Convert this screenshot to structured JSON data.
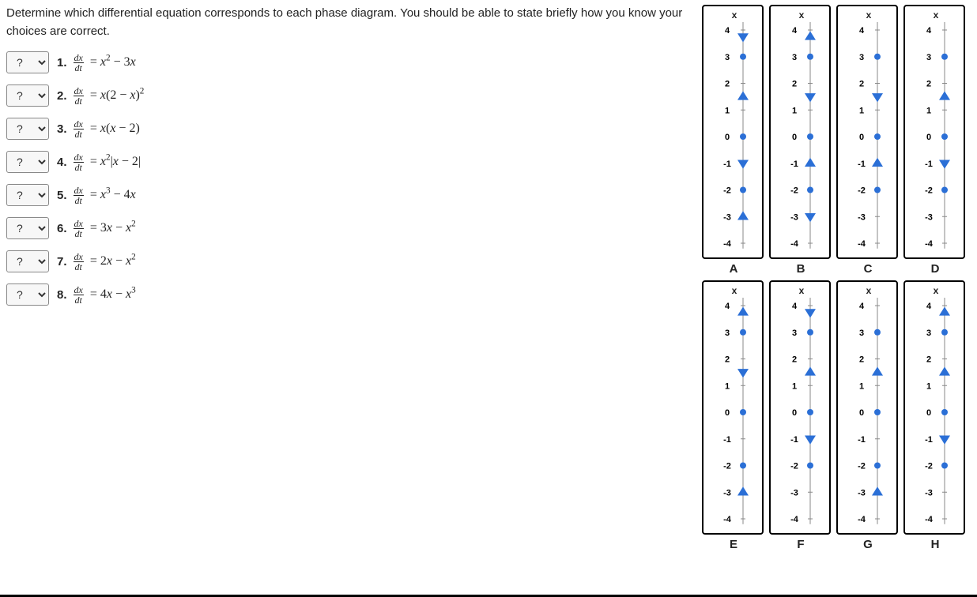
{
  "prompt": "Determine which differential equation corresponds to each phase diagram. You should be able to state briefly how you know your choices are correct.",
  "select_placeholder": "?",
  "questions": [
    {
      "num": "1.",
      "latex": "x² − 3x"
    },
    {
      "num": "2.",
      "latex": "x(2 − x)²"
    },
    {
      "num": "3.",
      "latex": "x(x − 2)"
    },
    {
      "num": "4.",
      "latex": "x²|x − 2|"
    },
    {
      "num": "5.",
      "latex": "x³ − 4x"
    },
    {
      "num": "6.",
      "latex": "3x − x²"
    },
    {
      "num": "7.",
      "latex": "2x − x²"
    },
    {
      "num": "8.",
      "latex": "4x − x³"
    }
  ],
  "diagrams": [
    {
      "label": "A",
      "equilibria": [
        -2,
        0,
        3
      ],
      "regions": [
        {
          "from": -4,
          "to": -2,
          "dir": "up"
        },
        {
          "from": -2,
          "to": 0,
          "dir": "down"
        },
        {
          "from": 0,
          "to": 3,
          "dir": "up"
        },
        {
          "from": 3,
          "to": 4.5,
          "dir": "down"
        }
      ]
    },
    {
      "label": "B",
      "equilibria": [
        -2,
        0,
        3
      ],
      "regions": [
        {
          "from": -4,
          "to": -2,
          "dir": "down"
        },
        {
          "from": -2,
          "to": 0,
          "dir": "up"
        },
        {
          "from": 0,
          "to": 3,
          "dir": "down"
        },
        {
          "from": 3,
          "to": 4.5,
          "dir": "up"
        }
      ]
    },
    {
      "label": "C",
      "equilibria": [
        -2,
        0,
        3
      ],
      "regions": [
        {
          "from": -4,
          "to": -2,
          "dir": "none"
        },
        {
          "from": -2,
          "to": 0,
          "dir": "up"
        },
        {
          "from": 0,
          "to": 3,
          "dir": "down"
        },
        {
          "from": 3,
          "to": 4.5,
          "dir": "none"
        }
      ]
    },
    {
      "label": "D",
      "equilibria": [
        -2,
        0,
        3
      ],
      "regions": [
        {
          "from": -4,
          "to": -2,
          "dir": "none"
        },
        {
          "from": -2,
          "to": 0,
          "dir": "down"
        },
        {
          "from": 0,
          "to": 3,
          "dir": "up"
        },
        {
          "from": 3,
          "to": 4.5,
          "dir": "none"
        }
      ]
    },
    {
      "label": "E",
      "equilibria": [
        -2,
        0,
        3
      ],
      "regions": [
        {
          "from": -4,
          "to": -2,
          "dir": "up"
        },
        {
          "from": -2,
          "to": 0,
          "dir": "none"
        },
        {
          "from": 0,
          "to": 3,
          "dir": "down"
        },
        {
          "from": 3,
          "to": 4.5,
          "dir": "up"
        }
      ]
    },
    {
      "label": "F",
      "equilibria": [
        -2,
        0,
        3
      ],
      "regions": [
        {
          "from": -4,
          "to": -2,
          "dir": "none"
        },
        {
          "from": -2,
          "to": 0,
          "dir": "down"
        },
        {
          "from": 0,
          "to": 3,
          "dir": "up"
        },
        {
          "from": 3,
          "to": 4.5,
          "dir": "down"
        }
      ]
    },
    {
      "label": "G",
      "equilibria": [
        -2,
        0,
        3
      ],
      "regions": [
        {
          "from": -4,
          "to": -2,
          "dir": "up"
        },
        {
          "from": -2,
          "to": 0,
          "dir": "none"
        },
        {
          "from": 0,
          "to": 3,
          "dir": "up"
        },
        {
          "from": 3,
          "to": 4.5,
          "dir": "none"
        }
      ]
    },
    {
      "label": "H",
      "equilibria": [
        -2,
        0,
        3
      ],
      "regions": [
        {
          "from": -4,
          "to": -2,
          "dir": "none"
        },
        {
          "from": -2,
          "to": 0,
          "dir": "down"
        },
        {
          "from": 0,
          "to": 3,
          "dir": "up"
        },
        {
          "from": 3,
          "to": 4.5,
          "dir": "up"
        }
      ]
    }
  ],
  "axis": {
    "min": -4,
    "max": 4,
    "label": "x"
  },
  "colors": {
    "arrow": "#2b6fd6",
    "dot": "#2b6fd6",
    "axis": "#888"
  }
}
